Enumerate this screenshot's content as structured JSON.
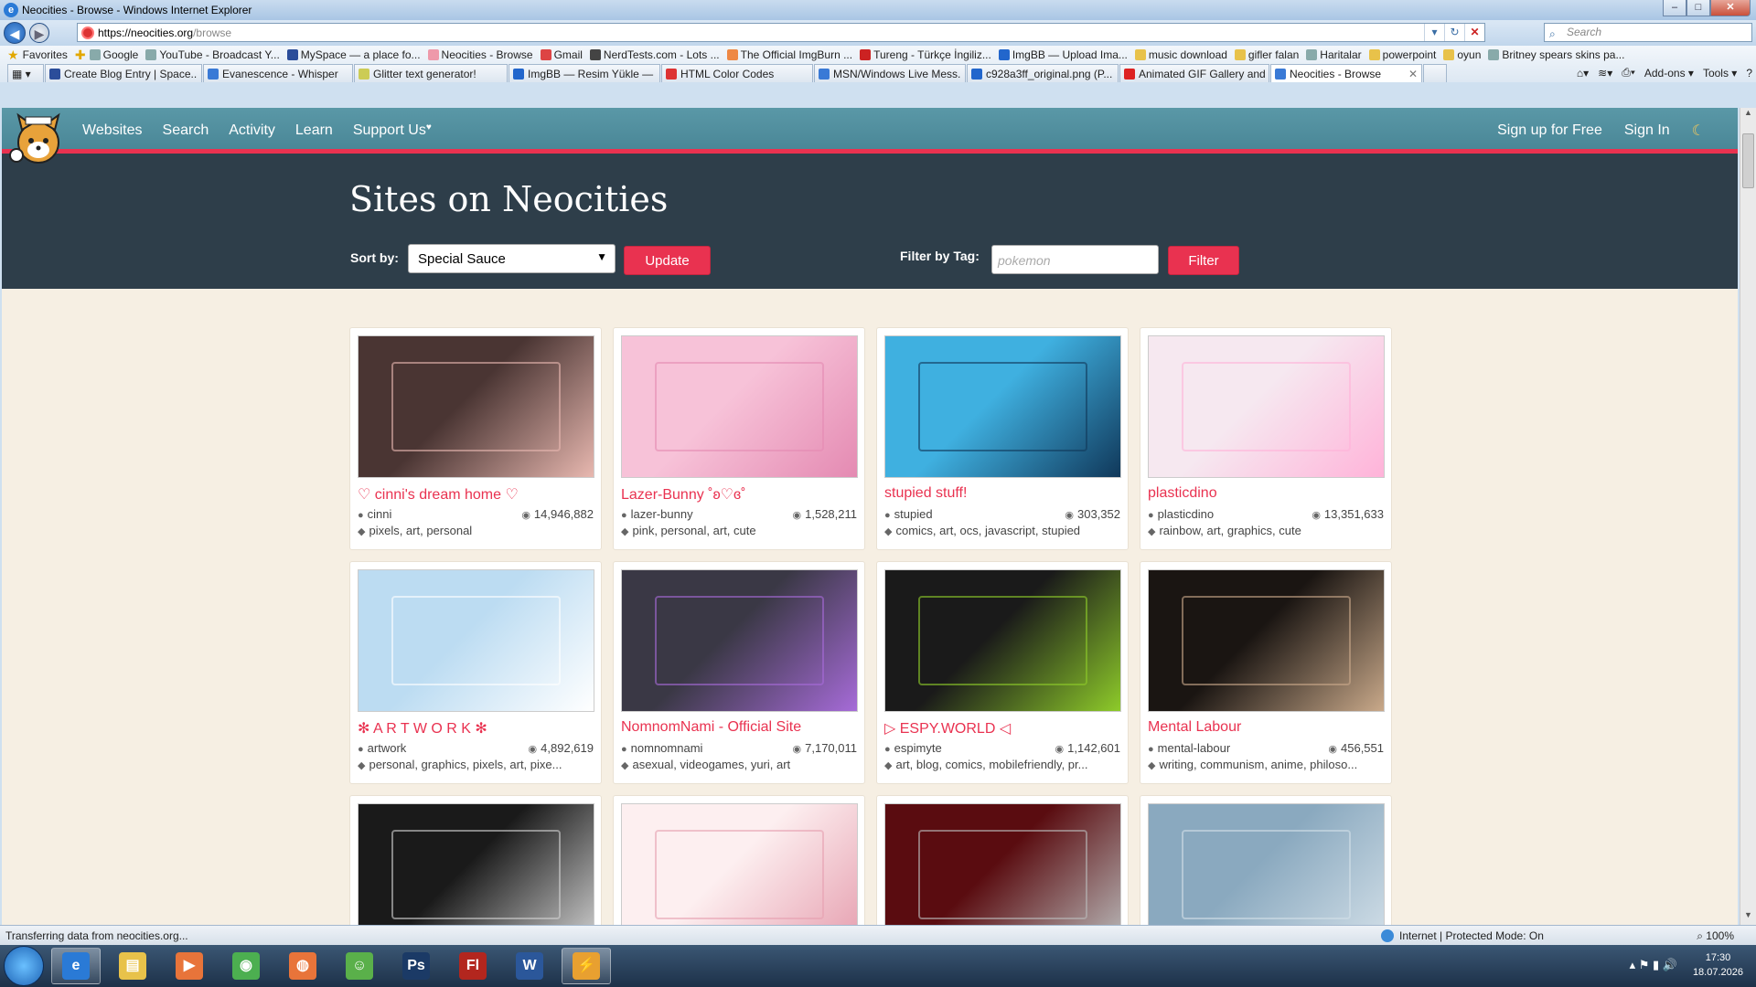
{
  "window": {
    "title": "Neocities - Browse - Windows Internet Explorer",
    "min": "–",
    "max": "□",
    "close": "✕"
  },
  "address": {
    "host": "https://neocities.org",
    "path": "/browse"
  },
  "ie_search": {
    "placeholder": "Search"
  },
  "favorites": {
    "label": "Favorites",
    "items": [
      {
        "label": "Google",
        "color": "#8aa"
      },
      {
        "label": "YouTube - Broadcast Y...",
        "color": "#8aa"
      },
      {
        "label": "MySpace — a place fo...",
        "color": "#2b4d9a"
      },
      {
        "label": "Neocities - Browse",
        "color": "#e9a"
      },
      {
        "label": "Gmail",
        "color": "#d44"
      },
      {
        "label": "NerdTests.com - Lots ...",
        "color": "#444"
      },
      {
        "label": "The Official ImgBurn ...",
        "color": "#e84"
      },
      {
        "label": "Tureng - Türkçe İngiliz...",
        "color": "#c22"
      },
      {
        "label": "ImgBB — Upload Ima...",
        "color": "#26c"
      },
      {
        "label": "music download",
        "color": "#e8c24a"
      },
      {
        "label": "gifler falan",
        "color": "#e8c24a"
      },
      {
        "label": "Haritalar",
        "color": "#8aa"
      },
      {
        "label": "powerpoint",
        "color": "#e8c24a"
      },
      {
        "label": "oyun",
        "color": "#e8c24a"
      },
      {
        "label": "Britney spears skins pa...",
        "color": "#8aa"
      }
    ]
  },
  "tabs": [
    {
      "label": "Create Blog Entry | Space...",
      "color": "#2b4d9a",
      "w": 172
    },
    {
      "label": "Evanescence - Whisper",
      "color": "#3a7ad6",
      "w": 164
    },
    {
      "label": "Glitter text generator!",
      "color": "#cc5",
      "w": 168
    },
    {
      "label": "ImgBB — Resim Yükle — ...",
      "color": "#26c",
      "w": 166
    },
    {
      "label": "HTML Color Codes",
      "color": "#d33",
      "w": 166
    },
    {
      "label": "MSN/Windows Live Mess...",
      "color": "#3a7ad6",
      "w": 166
    },
    {
      "label": "c928a3ff_original.png (P...",
      "color": "#26c",
      "w": 166
    },
    {
      "label": "Animated GIF Gallery and...",
      "color": "#d22",
      "w": 164
    },
    {
      "label": "Neocities - Browse",
      "color": "#3a7ad6",
      "w": 166,
      "active": true
    }
  ],
  "commandbar": {
    "addons": "Add-ons ▾",
    "tools": "Tools ▾",
    "help": "?"
  },
  "site": {
    "nav": [
      "Websites",
      "Search",
      "Activity",
      "Learn",
      "Support Us"
    ],
    "signup": "Sign up for Free",
    "signin": "Sign In",
    "heading": "Sites on Neocities",
    "sort_label": "Sort by:",
    "sort_value": "Special Sauce",
    "update": "Update",
    "filter_label": "Filter by Tag:",
    "filter_placeholder": "pokemon",
    "filter_btn": "Filter"
  },
  "sites": [
    {
      "title": "♡ cinni's dream home ♡",
      "user": "cinni",
      "views": "14,946,882",
      "tags": "pixels, art, personal",
      "bg": "#4a3533",
      "accent": "#e8b8b0"
    },
    {
      "title": "Lazer-Bunny ˚ʚ♡ɞ˚",
      "user": "lazer-bunny",
      "views": "1,528,211",
      "tags": "pink, personal, art, cute",
      "bg": "#f7c2d8",
      "accent": "#e48ab2"
    },
    {
      "title": "stupied stuff!",
      "user": "stupied",
      "views": "303,352",
      "tags": "comics, art, ocs, javascript, stupied",
      "bg": "#3fb0e0",
      "accent": "#10385a"
    },
    {
      "title": "plasticdino",
      "user": "plasticdino",
      "views": "13,351,633",
      "tags": "rainbow, art, graphics, cute",
      "bg": "#f6e8f0",
      "accent": "#ffb3d9"
    },
    {
      "title": "✻ A R T W O R K ✻",
      "user": "artwork",
      "views": "4,892,619",
      "tags": "personal, graphics, pixels, art, pixe...",
      "bg": "#bcdcf2",
      "accent": "#ffffff"
    },
    {
      "title": "NomnomNami - Official Site",
      "user": "nomnomnami",
      "views": "7,170,011",
      "tags": "asexual, videogames, yuri, art",
      "bg": "#3a3845",
      "accent": "#a66bd8"
    },
    {
      "title": "▷ ESPY.WORLD ◁",
      "user": "espimyte",
      "views": "1,142,601",
      "tags": "art, blog, comics, mobilefriendly, pr...",
      "bg": "#1a1a1a",
      "accent": "#8ecb2a"
    },
    {
      "title": "Mental Labour",
      "user": "mental-labour",
      "views": "456,551",
      "tags": "writing, communism, anime, philoso...",
      "bg": "#1a1512",
      "accent": "#c9a98a"
    },
    {
      "title": "",
      "user": "",
      "views": "",
      "tags": "",
      "bg": "#1a1a1a",
      "accent": "#cfcfcf"
    },
    {
      "title": "",
      "user": "",
      "views": "",
      "tags": "",
      "bg": "#fdeff0",
      "accent": "#e6a0b0"
    },
    {
      "title": "",
      "user": "",
      "views": "",
      "tags": "",
      "bg": "#5a0c10",
      "accent": "#b9b9b9"
    },
    {
      "title": "",
      "user": "",
      "views": "",
      "tags": "",
      "bg": "#8aa9bf",
      "accent": "#d2dfe8"
    }
  ],
  "status": {
    "text": "Transferring data from neocities.org...",
    "zone": "Internet | Protected Mode: On",
    "zoom": "100%"
  },
  "clock": {
    "time": "17:30",
    "date": "18.07.2026"
  },
  "taskbar": [
    {
      "name": "ie",
      "label": "e",
      "color": "#2a7ad6",
      "on": true
    },
    {
      "name": "explorer",
      "label": "▤",
      "color": "#e8c24a",
      "on": false
    },
    {
      "name": "media-player",
      "label": "▶",
      "color": "#e8743a",
      "on": false
    },
    {
      "name": "chrome",
      "label": "◉",
      "color": "#4caf50",
      "on": false
    },
    {
      "name": "firefox",
      "label": "◍",
      "color": "#e8743a",
      "on": false
    },
    {
      "name": "messenger",
      "label": "☺",
      "color": "#5ab04a",
      "on": false
    },
    {
      "name": "photoshop",
      "label": "Ps",
      "color": "#1b3a66",
      "on": false
    },
    {
      "name": "flash",
      "label": "Fl",
      "color": "#b3261e",
      "on": false
    },
    {
      "name": "word",
      "label": "W",
      "color": "#2b579a",
      "on": false
    },
    {
      "name": "app",
      "label": "⚡",
      "color": "#e8a030",
      "on": true
    }
  ]
}
